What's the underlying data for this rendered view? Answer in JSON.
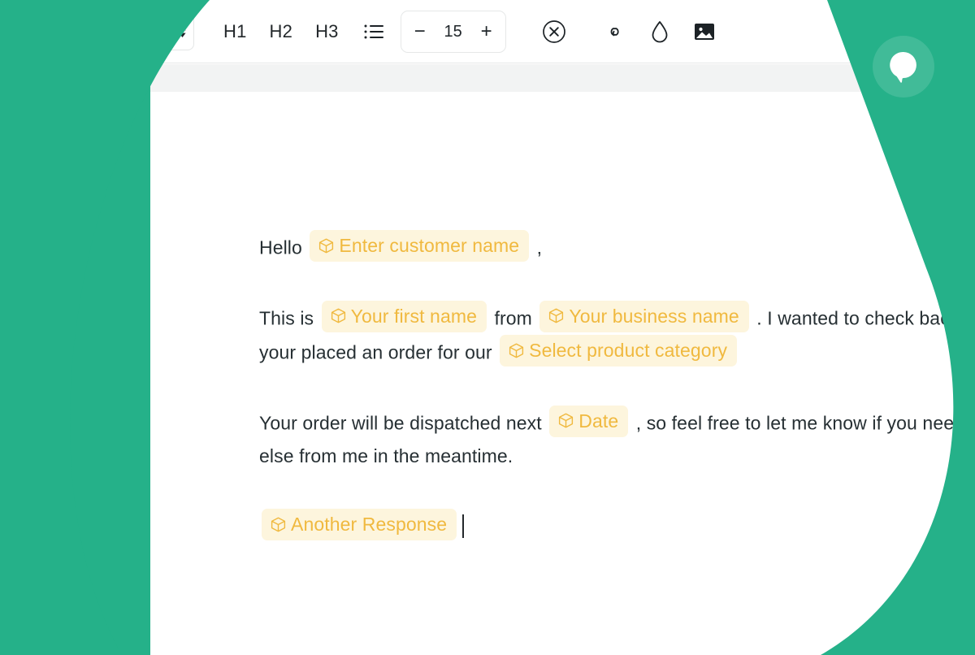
{
  "brand": {
    "green": "#25b189",
    "green_soft": "#3cbb97",
    "logo_icon": "chat-bubble-icon"
  },
  "toolbar": {
    "style_select": {
      "value": "",
      "caret_icon": "updown-caret-icon"
    },
    "headings": [
      {
        "label": "H1",
        "name": "heading-1-button"
      },
      {
        "label": "H2",
        "name": "heading-2-button"
      },
      {
        "label": "H3",
        "name": "heading-3-button"
      }
    ],
    "bullet_list_icon": "bullet-list-icon",
    "font_size": {
      "decrease_label": "−",
      "value": "15",
      "increase_label": "+"
    },
    "clear_format_icon": "circle-x-icon",
    "link_icon": "link-icon",
    "color_icon": "droplet-icon",
    "image_icon": "image-icon"
  },
  "editor": {
    "token_icon": "cube-icon",
    "token_bg": "#fdf5dd",
    "token_color": "#f0b93f",
    "paragraphs": [
      {
        "id": "greeting",
        "parts": [
          {
            "type": "text",
            "value": "Hello "
          },
          {
            "type": "token",
            "value": "Enter customer name"
          },
          {
            "type": "text",
            "value": " ,"
          }
        ]
      },
      {
        "id": "intro",
        "parts": [
          {
            "type": "text",
            "value": "This is "
          },
          {
            "type": "token",
            "value": "Your first name"
          },
          {
            "type": "text",
            "value": " from "
          },
          {
            "type": "token",
            "value": "Your business name"
          },
          {
            "type": "text",
            "value": " . I wanted to check back today since your placed an order for our "
          },
          {
            "type": "token",
            "value": "Select product category"
          }
        ]
      },
      {
        "id": "dispatch",
        "parts": [
          {
            "type": "text",
            "value": "Your order will be dispatched next "
          },
          {
            "type": "token",
            "value": "Date"
          },
          {
            "type": "text",
            "value": " , so feel free to let me know if you need anything else from me in the meantime."
          }
        ]
      },
      {
        "id": "another",
        "parts": [
          {
            "type": "token",
            "value": "Another Response"
          },
          {
            "type": "caret"
          }
        ]
      }
    ]
  }
}
